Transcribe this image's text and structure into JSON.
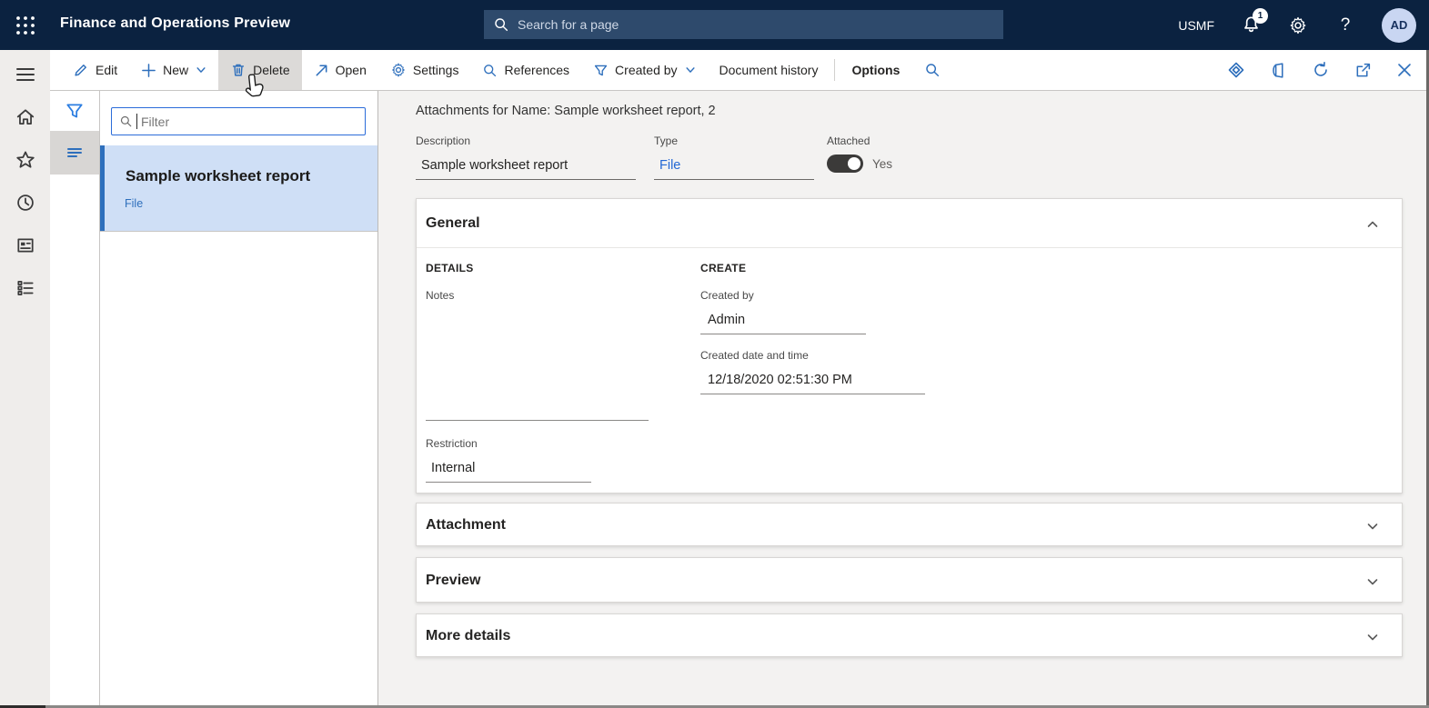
{
  "colors": {
    "topbar_bg": "#0b2240",
    "accent_blue": "#2e6fbc",
    "link_blue": "#2468d4",
    "selection_bg": "#cfdff6"
  },
  "topbar": {
    "app_title": "Finance and Operations Preview",
    "search_placeholder": "Search for a page",
    "search_value": "",
    "company": "USMF",
    "notification_count": "1",
    "help_label": "?",
    "avatar_initials": "AD"
  },
  "action_bar": {
    "edit": "Edit",
    "new": "New",
    "delete": "Delete",
    "open": "Open",
    "settings": "Settings",
    "references": "References",
    "created_by": "Created by",
    "document_history": "Document history",
    "options": "Options"
  },
  "left_panel": {
    "filter_placeholder": "Filter",
    "filter_value": "",
    "items": [
      {
        "title": "Sample worksheet report",
        "subtitle": "File",
        "selected": true
      }
    ]
  },
  "main": {
    "title": "Attachments for Name: Sample worksheet report, 2",
    "description_label": "Description",
    "description_value": "Sample worksheet report",
    "type_label": "Type",
    "type_value": "File",
    "attached_label": "Attached",
    "attached_state": "Yes",
    "sections": {
      "general": {
        "title": "General",
        "details_heading": "DETAILS",
        "create_heading": "CREATE",
        "notes_label": "Notes",
        "notes_value": "",
        "restriction_label": "Restriction",
        "restriction_value": "Internal",
        "created_by_label": "Created by",
        "created_by_value": "Admin",
        "created_datetime_label": "Created date and time",
        "created_datetime_value": "12/18/2020 02:51:30 PM"
      },
      "attachment": {
        "title": "Attachment"
      },
      "preview": {
        "title": "Preview"
      },
      "more_details": {
        "title": "More details"
      }
    }
  }
}
